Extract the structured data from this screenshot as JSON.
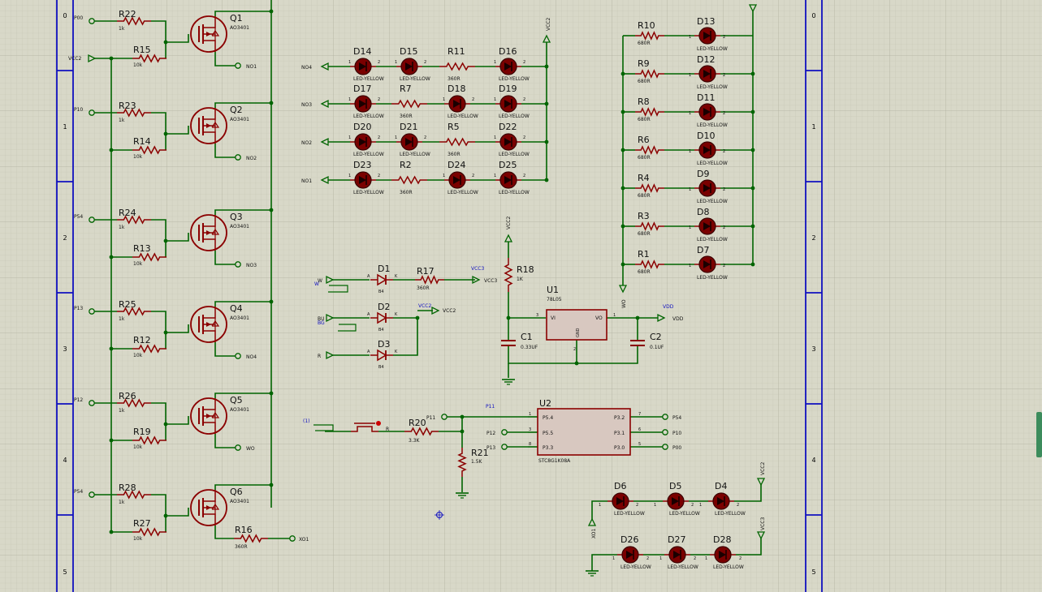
{
  "border": {
    "rows": [
      "0",
      "1",
      "2",
      "3",
      "4",
      "5"
    ]
  },
  "nmos": [
    {
      "ref": "Q1",
      "part": "AO3401",
      "in": "P00",
      "rs": "R22",
      "rsv": "1k",
      "rp": "R15",
      "rpv": "10k",
      "out": "NO1"
    },
    {
      "ref": "Q2",
      "part": "AO3401",
      "in": "P10",
      "rs": "R23",
      "rsv": "1k",
      "rp": "R14",
      "rpv": "10k",
      "out": "NO2"
    },
    {
      "ref": "Q3",
      "part": "AO3401",
      "in": "P54",
      "rs": "R24",
      "rsv": "1k",
      "rp": "R13",
      "rpv": "10k",
      "out": "NO3"
    },
    {
      "ref": "Q4",
      "part": "AO3401",
      "in": "P13",
      "rs": "R25",
      "rsv": "1k",
      "rp": "R12",
      "rpv": "10k",
      "out": "NO4"
    },
    {
      "ref": "Q5",
      "part": "AO3401",
      "in": "P12",
      "rs": "R26",
      "rsv": "1k",
      "rp": "R19",
      "rpv": "10k",
      "out": "WO"
    },
    {
      "ref": "Q6",
      "part": "AO3401",
      "in": "P54",
      "rs": "R28",
      "rsv": "1k",
      "rp": "R27",
      "rpv": "10k",
      "out": ""
    }
  ],
  "vcc2_left": "VCC2",
  "xo1": {
    "ref": "R16",
    "val": "360R",
    "net": "XO1"
  },
  "led_rows": [
    {
      "net": "NO4",
      "items": [
        [
          "D14",
          "LED-YELLOW"
        ],
        [
          "D15",
          "LED-YELLOW"
        ],
        [
          "R11",
          "360R"
        ],
        [
          "D16",
          "LED-YELLOW"
        ]
      ]
    },
    {
      "net": "NO3",
      "items": [
        [
          "D17",
          "LED-YELLOW"
        ],
        [
          "R7",
          "360R"
        ],
        [
          "D18",
          "LED-YELLOW"
        ],
        [
          "D19",
          "LED-YELLOW"
        ]
      ]
    },
    {
      "net": "NO2",
      "items": [
        [
          "D20",
          "LED-YELLOW"
        ],
        [
          "D21",
          "LED-YELLOW"
        ],
        [
          "R5",
          "360R"
        ],
        [
          "D22",
          "LED-YELLOW"
        ]
      ]
    },
    {
      "net": "NO1",
      "items": [
        [
          "D23",
          "LED-YELLOW"
        ],
        [
          "R2",
          "360R"
        ],
        [
          "D24",
          "LED-YELLOW"
        ],
        [
          "D25",
          "LED-YELLOW"
        ]
      ]
    }
  ],
  "vcc2_top": "VCC2",
  "right_leds": [
    {
      "r": "R10",
      "rv": "680R",
      "d": "D13",
      "dv": "LED-YELLOW"
    },
    {
      "r": "R9",
      "rv": "680R",
      "d": "D12",
      "dv": "LED-YELLOW"
    },
    {
      "r": "R8",
      "rv": "680R",
      "d": "D11",
      "dv": "LED-YELLOW"
    },
    {
      "r": "R6",
      "rv": "680R",
      "d": "D10",
      "dv": "LED-YELLOW"
    },
    {
      "r": "R4",
      "rv": "680R",
      "d": "D9",
      "dv": "LED-YELLOW"
    },
    {
      "r": "R3",
      "rv": "680R",
      "d": "D8",
      "dv": "LED-YELLOW"
    },
    {
      "r": "R1",
      "rv": "680R",
      "d": "D7",
      "dv": "LED-YELLOW"
    }
  ],
  "wo_net": "WO",
  "power": {
    "w": "W",
    "bu": "BU",
    "bg": "BG",
    "r": "R",
    "a": "A",
    "k": "K",
    "d1": "D1",
    "d2": "D2",
    "d3": "D3",
    "dv": "B4",
    "r17": "R17",
    "r17v": "360R",
    "vcc3": "VCC3",
    "vcc2": "VCC2",
    "r18": "R18",
    "r18v": "1K",
    "vcc2_top": "VCC2",
    "u1": "U1",
    "u1v": "78L05",
    "vi": "VI",
    "vo": "VO",
    "gnd": "GND",
    "c1": "C1",
    "c1v": "0.33UF",
    "c2": "C2",
    "c2v": "0.1UF",
    "vdd": "VDD",
    "pin3": "3",
    "pin1": "1",
    "pin2": "2"
  },
  "mcu": {
    "tag1": "(1)",
    "sw_r": "R",
    "r20": "R20",
    "r20v": "3.3K",
    "r21": "R21",
    "r21v": "1.5K",
    "p11": "P11",
    "p11b": "P11",
    "p12": "P12",
    "p13": "P13",
    "u2": "U2",
    "u2v": "STC8G1K08A",
    "pins_l": [
      [
        "1",
        "P5.4"
      ],
      [
        "3",
        "P5.5"
      ],
      [
        "8",
        "P3.3"
      ]
    ],
    "pins_r": [
      [
        "7",
        "P3.2",
        "P54"
      ],
      [
        "6",
        "P3.1",
        "P10"
      ],
      [
        "5",
        "P3.0",
        "P00"
      ]
    ]
  },
  "bottom": {
    "row1": [
      [
        "D6",
        "LED-YELLOW"
      ],
      [
        "D5",
        "LED-YELLOW"
      ],
      [
        "D4",
        "LED-YELLOW"
      ]
    ],
    "row2": [
      [
        "D26",
        "LED-YELLOW"
      ],
      [
        "D27",
        "LED-YELLOW"
      ],
      [
        "D28",
        "LED-YELLOW"
      ]
    ],
    "xo1": "XO1",
    "vcc2": "VCC2",
    "vcc3": "VCC3"
  },
  "pin_nums": {
    "one": "1",
    "two": "2"
  }
}
